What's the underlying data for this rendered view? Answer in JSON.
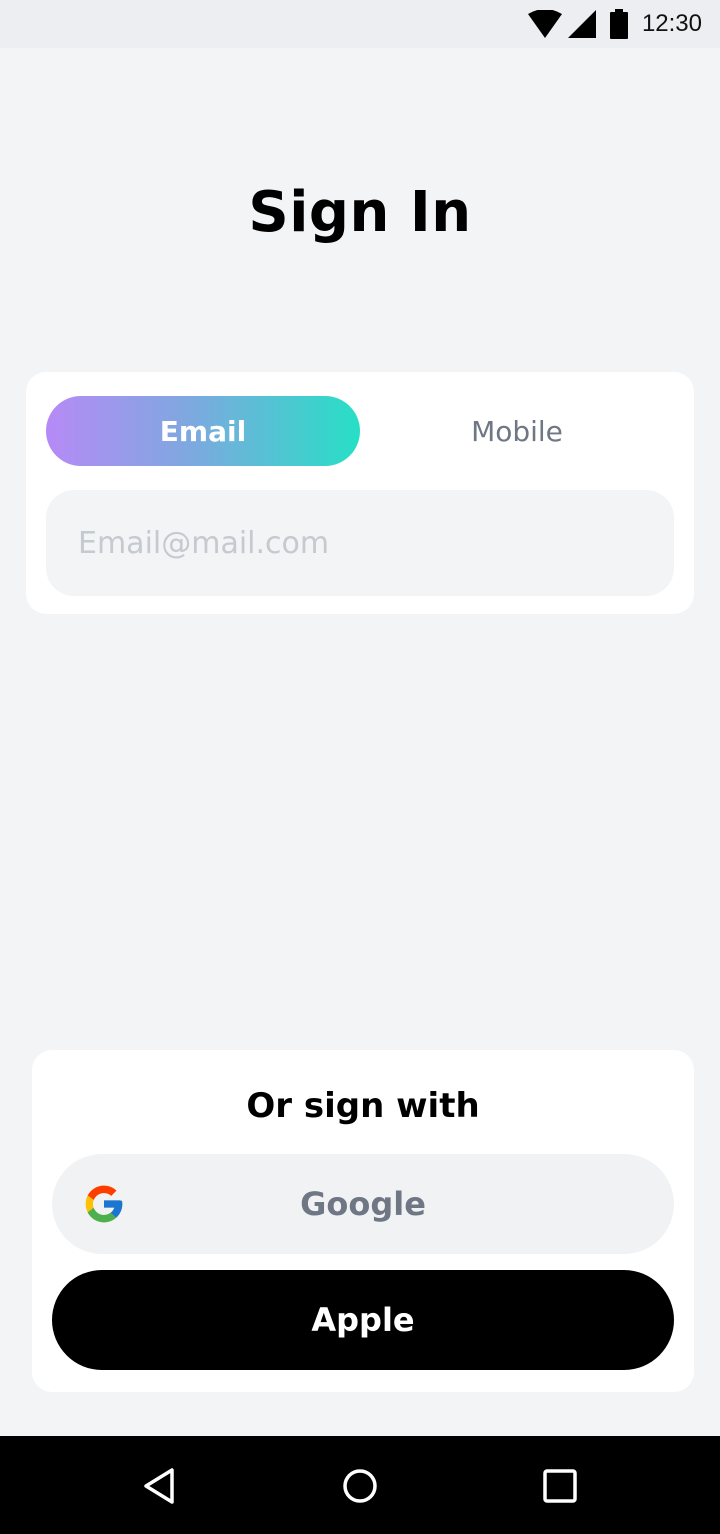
{
  "status_bar": {
    "time": "12:30",
    "icons": [
      "wifi-icon",
      "cellular-signal-icon",
      "battery-icon"
    ]
  },
  "page": {
    "title": "Sign In"
  },
  "auth_tabs": {
    "email_label": "Email",
    "mobile_label": "Mobile",
    "active": "Email"
  },
  "email_input": {
    "placeholder": "Email@mail.com",
    "value": ""
  },
  "social": {
    "title": "Or sign with",
    "google_label": "Google",
    "apple_label": "Apple"
  },
  "nav_bar": {
    "icons": [
      "back-icon",
      "home-icon",
      "recents-icon"
    ]
  },
  "colors": {
    "background": "#f3f4f6",
    "tab_gradient_start": "#b68af6",
    "tab_gradient_end": "#27dfc6",
    "apple_button": "#000000",
    "muted_text": "#6f7784"
  }
}
